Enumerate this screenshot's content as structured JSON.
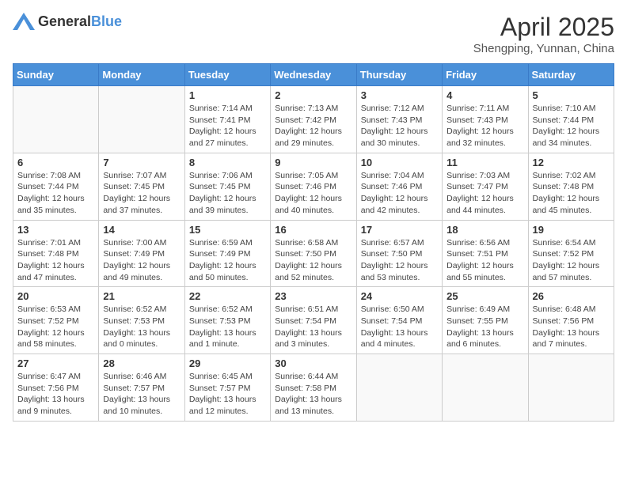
{
  "logo": {
    "text_general": "General",
    "text_blue": "Blue"
  },
  "title": "April 2025",
  "subtitle": "Shengping, Yunnan, China",
  "days_of_week": [
    "Sunday",
    "Monday",
    "Tuesday",
    "Wednesday",
    "Thursday",
    "Friday",
    "Saturday"
  ],
  "weeks": [
    [
      {
        "day": "",
        "info": ""
      },
      {
        "day": "",
        "info": ""
      },
      {
        "day": "1",
        "info": "Sunrise: 7:14 AM\nSunset: 7:41 PM\nDaylight: 12 hours and 27 minutes."
      },
      {
        "day": "2",
        "info": "Sunrise: 7:13 AM\nSunset: 7:42 PM\nDaylight: 12 hours and 29 minutes."
      },
      {
        "day": "3",
        "info": "Sunrise: 7:12 AM\nSunset: 7:43 PM\nDaylight: 12 hours and 30 minutes."
      },
      {
        "day": "4",
        "info": "Sunrise: 7:11 AM\nSunset: 7:43 PM\nDaylight: 12 hours and 32 minutes."
      },
      {
        "day": "5",
        "info": "Sunrise: 7:10 AM\nSunset: 7:44 PM\nDaylight: 12 hours and 34 minutes."
      }
    ],
    [
      {
        "day": "6",
        "info": "Sunrise: 7:08 AM\nSunset: 7:44 PM\nDaylight: 12 hours and 35 minutes."
      },
      {
        "day": "7",
        "info": "Sunrise: 7:07 AM\nSunset: 7:45 PM\nDaylight: 12 hours and 37 minutes."
      },
      {
        "day": "8",
        "info": "Sunrise: 7:06 AM\nSunset: 7:45 PM\nDaylight: 12 hours and 39 minutes."
      },
      {
        "day": "9",
        "info": "Sunrise: 7:05 AM\nSunset: 7:46 PM\nDaylight: 12 hours and 40 minutes."
      },
      {
        "day": "10",
        "info": "Sunrise: 7:04 AM\nSunset: 7:46 PM\nDaylight: 12 hours and 42 minutes."
      },
      {
        "day": "11",
        "info": "Sunrise: 7:03 AM\nSunset: 7:47 PM\nDaylight: 12 hours and 44 minutes."
      },
      {
        "day": "12",
        "info": "Sunrise: 7:02 AM\nSunset: 7:48 PM\nDaylight: 12 hours and 45 minutes."
      }
    ],
    [
      {
        "day": "13",
        "info": "Sunrise: 7:01 AM\nSunset: 7:48 PM\nDaylight: 12 hours and 47 minutes."
      },
      {
        "day": "14",
        "info": "Sunrise: 7:00 AM\nSunset: 7:49 PM\nDaylight: 12 hours and 49 minutes."
      },
      {
        "day": "15",
        "info": "Sunrise: 6:59 AM\nSunset: 7:49 PM\nDaylight: 12 hours and 50 minutes."
      },
      {
        "day": "16",
        "info": "Sunrise: 6:58 AM\nSunset: 7:50 PM\nDaylight: 12 hours and 52 minutes."
      },
      {
        "day": "17",
        "info": "Sunrise: 6:57 AM\nSunset: 7:50 PM\nDaylight: 12 hours and 53 minutes."
      },
      {
        "day": "18",
        "info": "Sunrise: 6:56 AM\nSunset: 7:51 PM\nDaylight: 12 hours and 55 minutes."
      },
      {
        "day": "19",
        "info": "Sunrise: 6:54 AM\nSunset: 7:52 PM\nDaylight: 12 hours and 57 minutes."
      }
    ],
    [
      {
        "day": "20",
        "info": "Sunrise: 6:53 AM\nSunset: 7:52 PM\nDaylight: 12 hours and 58 minutes."
      },
      {
        "day": "21",
        "info": "Sunrise: 6:52 AM\nSunset: 7:53 PM\nDaylight: 13 hours and 0 minutes."
      },
      {
        "day": "22",
        "info": "Sunrise: 6:52 AM\nSunset: 7:53 PM\nDaylight: 13 hours and 1 minute."
      },
      {
        "day": "23",
        "info": "Sunrise: 6:51 AM\nSunset: 7:54 PM\nDaylight: 13 hours and 3 minutes."
      },
      {
        "day": "24",
        "info": "Sunrise: 6:50 AM\nSunset: 7:54 PM\nDaylight: 13 hours and 4 minutes."
      },
      {
        "day": "25",
        "info": "Sunrise: 6:49 AM\nSunset: 7:55 PM\nDaylight: 13 hours and 6 minutes."
      },
      {
        "day": "26",
        "info": "Sunrise: 6:48 AM\nSunset: 7:56 PM\nDaylight: 13 hours and 7 minutes."
      }
    ],
    [
      {
        "day": "27",
        "info": "Sunrise: 6:47 AM\nSunset: 7:56 PM\nDaylight: 13 hours and 9 minutes."
      },
      {
        "day": "28",
        "info": "Sunrise: 6:46 AM\nSunset: 7:57 PM\nDaylight: 13 hours and 10 minutes."
      },
      {
        "day": "29",
        "info": "Sunrise: 6:45 AM\nSunset: 7:57 PM\nDaylight: 13 hours and 12 minutes."
      },
      {
        "day": "30",
        "info": "Sunrise: 6:44 AM\nSunset: 7:58 PM\nDaylight: 13 hours and 13 minutes."
      },
      {
        "day": "",
        "info": ""
      },
      {
        "day": "",
        "info": ""
      },
      {
        "day": "",
        "info": ""
      }
    ]
  ]
}
